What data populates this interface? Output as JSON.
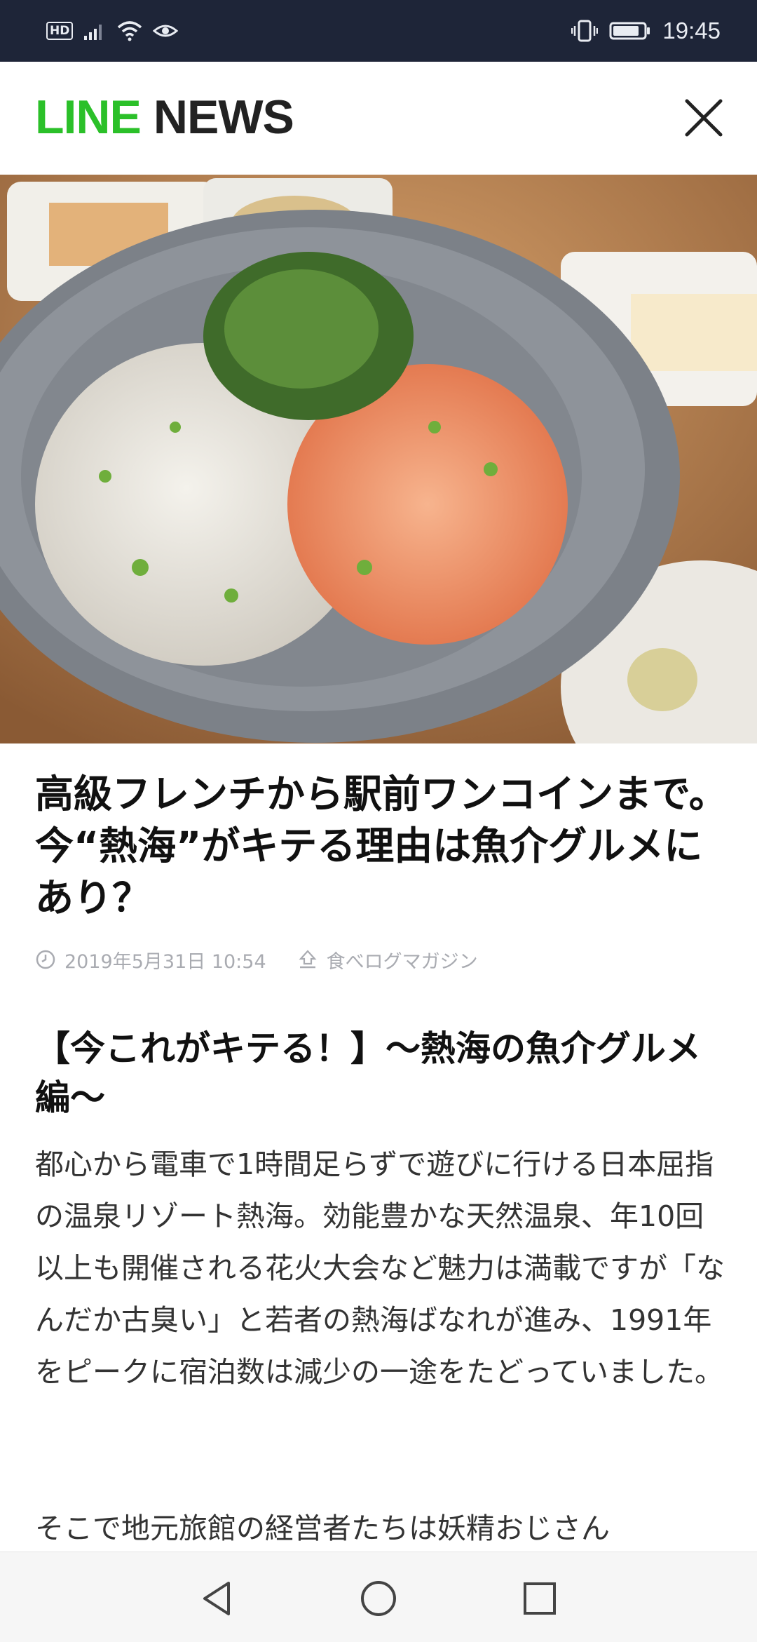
{
  "status_bar": {
    "hd_label": "HD",
    "time": "19:45",
    "icons": [
      "hd-icon",
      "signal-icon",
      "wifi-icon",
      "eye-icon",
      "vibrate-icon",
      "battery-icon"
    ]
  },
  "header": {
    "brand_line": "LINE",
    "brand_news": "NEWS",
    "brand_color": "#2bc029",
    "close_icon": "close-icon"
  },
  "hero": {
    "image": "food-bowl-photo"
  },
  "article": {
    "title": "高級フレンチから駅前ワンコインまで。今“熱海”がキテる理由は魚介グルメにあり？",
    "date": "2019年5月31日 10:54",
    "source": "食べログマガジン",
    "section_heading": "【今これがキテる！】〜熱海の魚介グルメ編〜",
    "paragraph1": "都心から電車で1時間足らずで遊びに行ける日本屈指の温泉リゾート熱海。効能豊かな天然温泉、年10回以上も開催される花火大会など魅力は満載ですが「なんだか古臭い」と若者の熱海ばなれが進み、1991年をピークに宿泊数は減少の一途をたどっていました。",
    "paragraph2": "そこで地元旅館の経営者たちは妖精おじさん"
  },
  "nav_bar": {
    "buttons": [
      "back-icon",
      "home-icon",
      "recents-icon"
    ]
  }
}
